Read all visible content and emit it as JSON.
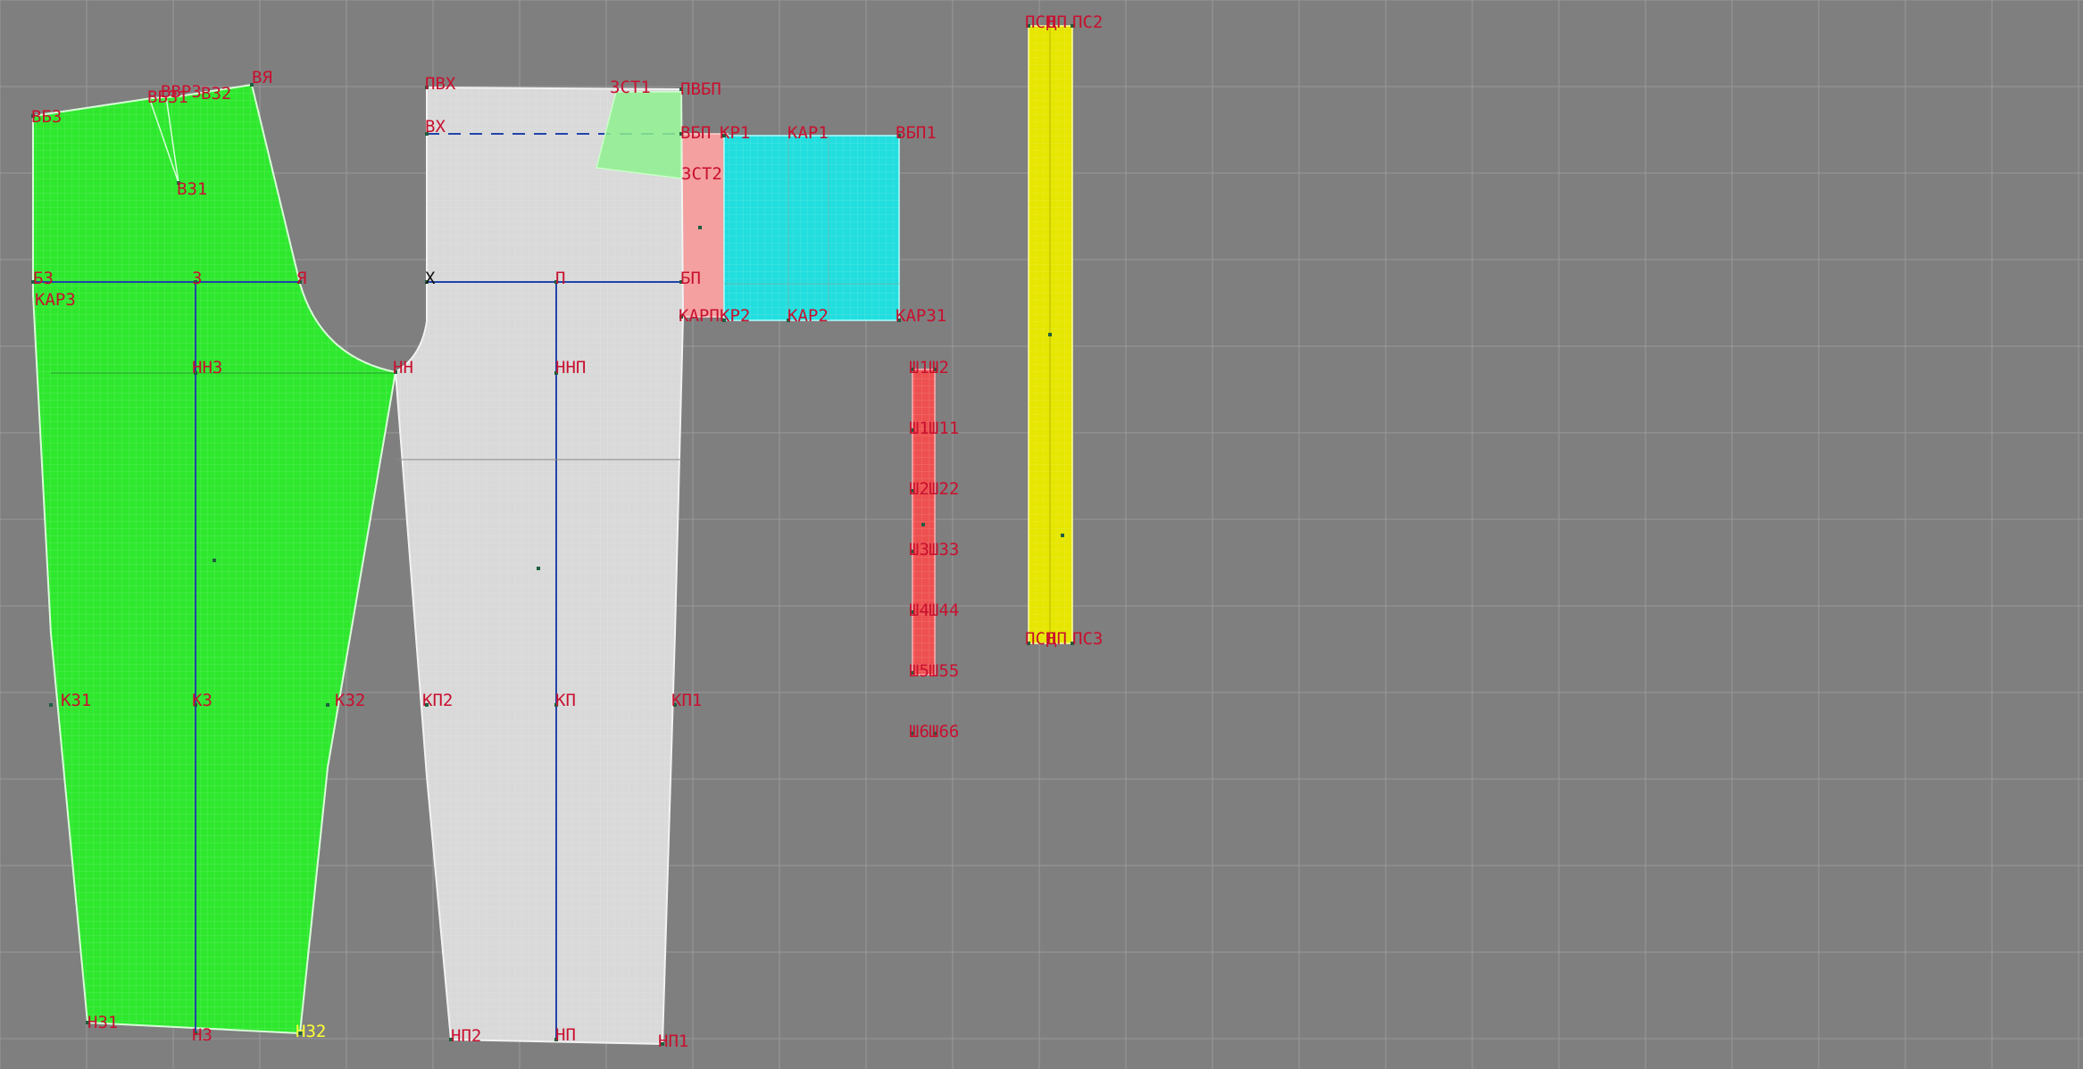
{
  "colors": {
    "background": "#7f7f7f",
    "grid": "#9a9a9a",
    "back_piece": "#2ee82e",
    "front_piece": "#d9d9d9",
    "waistband_piece": "#e6e600",
    "pocket_facing": "#22dede",
    "belt_loop_strip": "#ee5050",
    "coin_pocket": "#8ef08e",
    "pocket_lining": "#f4a0a0",
    "point_label": "#c8102e",
    "grain_line": "#2244aa"
  },
  "icons": {
    "point_marker": "point-marker-icon"
  },
  "pieces": {
    "back": {
      "labels": {
        "vbz": "ВБЗ",
        "vbz1": "ВБЗ1",
        "vvrz": "ВВРЗ",
        "vz2": "ВЗ2",
        "vya": "ВЯ",
        "vz1": "ВЗ1",
        "bz": "БЗ",
        "z": "З",
        "ya": "Я",
        "karz": "КАРЗ",
        "nnz": "ННЗ",
        "kz1": "КЗ1",
        "kz": "КЗ",
        "kz2": "КЗ2",
        "nz1": "НЗ1",
        "nz": "НЗ",
        "nz2": "НЗ2"
      }
    },
    "front": {
      "labels": {
        "pvh": "ПВХ",
        "vh": "ВХ",
        "zst1": "ЗСТ1",
        "pvbp": "ПВБП",
        "vbp": "ВБП",
        "zst2": "ЗСТ2",
        "h": "Х",
        "p": "П",
        "bp": "БП",
        "karp": "КАРП",
        "nn": "НН",
        "nnp": "ННП",
        "kp2": "КП2",
        "kp": "КП",
        "kp1": "КП1",
        "np2": "НП2",
        "np": "НП",
        "np1": "НП1"
      }
    },
    "pocket": {
      "labels": {
        "kr1": "КР1",
        "kar1": "КАР1",
        "vbp1": "ВБП1",
        "kr2": "КР2",
        "kar2": "КАР2",
        "kar31": "КАР31"
      }
    },
    "strip": {
      "labels": {
        "sh2a": "Ш1",
        "sh2b": "Ш2",
        "sh11a": "Ш1",
        "sh11b": "Ш11",
        "sh22a": "Ш2",
        "sh22b": "Ш22",
        "sh33a": "Ш3",
        "sh33b": "Ш33",
        "sh44a": "Ш4",
        "sh44b": "Ш44",
        "sh55a": "Ш5",
        "sh55b": "Ш55",
        "sh66a": "Ш6",
        "sh66b": "Ш66"
      }
    },
    "waistband": {
      "labels": {
        "top_a": "ПСН",
        "top_b": "ДП",
        "top_c": "ПС2",
        "bot_a": "ПСН",
        "bot_b": "ДП",
        "bot_c": "ПС3"
      }
    }
  }
}
